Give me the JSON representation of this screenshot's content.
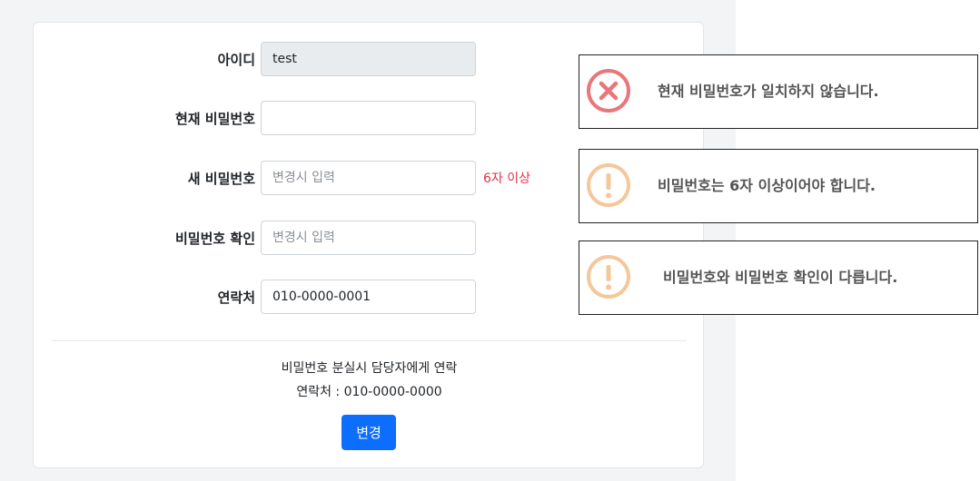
{
  "form": {
    "id_label": "아이디",
    "id_value": "test",
    "current_pw_label": "현재 비밀번호",
    "current_pw_value": "",
    "new_pw_label": "새 비밀번호",
    "new_pw_placeholder": "변경시 입력",
    "new_pw_hint": "6자 이상",
    "confirm_pw_label": "비밀번호 확인",
    "confirm_pw_placeholder": "변경시 입력",
    "contact_label": "연락처",
    "contact_value": "010-0000-0001"
  },
  "footer": {
    "note_line1": "비밀번호 분실시 담당자에게 연락",
    "note_line2": "연락처 : 010-0000-0000",
    "submit_label": "변경"
  },
  "alerts": [
    {
      "icon": "error-x-icon",
      "color": "#e8767a",
      "message": "현재 비밀번호가 일치하지 않습니다."
    },
    {
      "icon": "warning-exclamation-icon",
      "color": "#f5c79a",
      "message": "비밀번호는 6자 이상이어야 합니다."
    },
    {
      "icon": "warning-exclamation-icon",
      "color": "#f5c79a",
      "message": "비밀번호와 비밀번호 확인이 다릅니다."
    }
  ]
}
